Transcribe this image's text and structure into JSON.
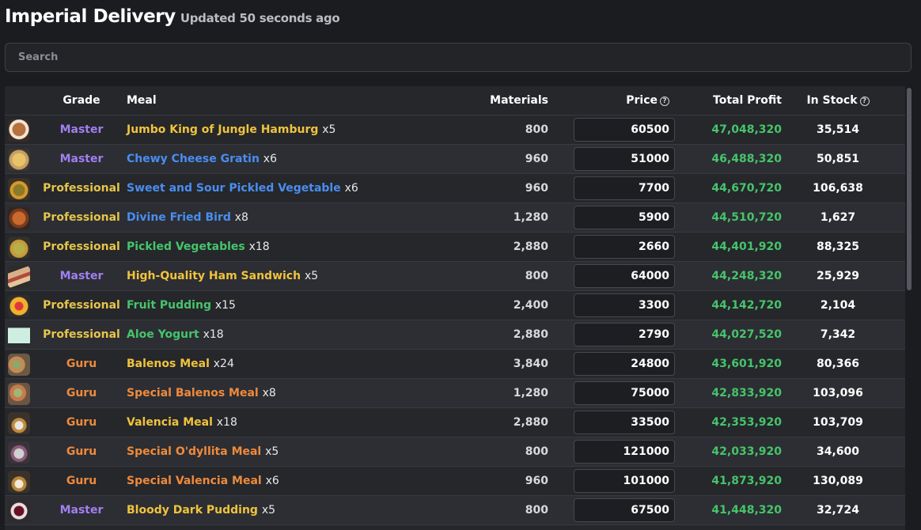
{
  "header": {
    "title": "Imperial Delivery",
    "updated": "Updated 50 seconds ago"
  },
  "search": {
    "placeholder": "Search"
  },
  "columns": {
    "grade": "Grade",
    "meal": "Meal",
    "materials": "Materials",
    "price": "Price",
    "total_profit": "Total Profit",
    "in_stock": "In Stock",
    "help_glyph": "?"
  },
  "colors": {
    "grade": {
      "Master": "#a07ff0",
      "Professional": "#e6c54a",
      "Guru": "#ef8a3c"
    },
    "meal_quality": {
      "yellow": "#f0c33c",
      "blue": "#4a8df0",
      "green": "#46c46b",
      "orange": "#ef8a3c"
    },
    "profit": "#46c46b"
  },
  "rows": [
    {
      "icon": "hamburger-icon",
      "grade": "Master",
      "meal": "Jumbo King of Jungle Hamburg",
      "meal_color": "yellow",
      "qty": "x5",
      "materials": "800",
      "price": "60500",
      "total_profit": "47,048,320",
      "in_stock": "35,514"
    },
    {
      "icon": "gratin-icon",
      "grade": "Master",
      "meal": "Chewy Cheese Gratin",
      "meal_color": "blue",
      "qty": "x6",
      "materials": "960",
      "price": "51000",
      "total_profit": "46,488,320",
      "in_stock": "50,851"
    },
    {
      "icon": "pickled-vegetable-icon",
      "grade": "Professional",
      "meal": "Sweet and Sour Pickled Vegetable",
      "meal_color": "blue",
      "qty": "x6",
      "materials": "960",
      "price": "7700",
      "total_profit": "44,670,720",
      "in_stock": "106,638"
    },
    {
      "icon": "fried-bird-icon",
      "grade": "Professional",
      "meal": "Divine Fried Bird",
      "meal_color": "blue",
      "qty": "x8",
      "materials": "1,280",
      "price": "5900",
      "total_profit": "44,510,720",
      "in_stock": "1,627"
    },
    {
      "icon": "pickled-vegetables-icon",
      "grade": "Professional",
      "meal": "Pickled Vegetables",
      "meal_color": "green",
      "qty": "x18",
      "materials": "2,880",
      "price": "2660",
      "total_profit": "44,401,920",
      "in_stock": "88,325"
    },
    {
      "icon": "ham-sandwich-icon",
      "grade": "Master",
      "meal": "High-Quality Ham Sandwich",
      "meal_color": "yellow",
      "qty": "x5",
      "materials": "800",
      "price": "64000",
      "total_profit": "44,248,320",
      "in_stock": "25,929"
    },
    {
      "icon": "fruit-pudding-icon",
      "grade": "Professional",
      "meal": "Fruit Pudding",
      "meal_color": "green",
      "qty": "x15",
      "materials": "2,400",
      "price": "3300",
      "total_profit": "44,142,720",
      "in_stock": "2,104"
    },
    {
      "icon": "yogurt-icon",
      "grade": "Professional",
      "meal": "Aloe Yogurt",
      "meal_color": "green",
      "qty": "x18",
      "materials": "2,880",
      "price": "2790",
      "total_profit": "44,027,520",
      "in_stock": "7,342"
    },
    {
      "icon": "balenos-meal-icon",
      "grade": "Guru",
      "meal": "Balenos Meal",
      "meal_color": "yellow",
      "qty": "x24",
      "materials": "3,840",
      "price": "24800",
      "total_profit": "43,601,920",
      "in_stock": "80,366"
    },
    {
      "icon": "special-balenos-meal-icon",
      "grade": "Guru",
      "meal": "Special Balenos Meal",
      "meal_color": "orange",
      "qty": "x8",
      "materials": "1,280",
      "price": "75000",
      "total_profit": "42,833,920",
      "in_stock": "103,096"
    },
    {
      "icon": "valencia-meal-icon",
      "grade": "Guru",
      "meal": "Valencia Meal",
      "meal_color": "yellow",
      "qty": "x18",
      "materials": "2,880",
      "price": "33500",
      "total_profit": "42,353,920",
      "in_stock": "103,709"
    },
    {
      "icon": "odyllita-meal-icon",
      "grade": "Guru",
      "meal": "Special O'dyllita Meal",
      "meal_color": "orange",
      "qty": "x5",
      "materials": "800",
      "price": "121000",
      "total_profit": "42,033,920",
      "in_stock": "34,600"
    },
    {
      "icon": "special-valencia-meal-icon",
      "grade": "Guru",
      "meal": "Special Valencia Meal",
      "meal_color": "orange",
      "qty": "x6",
      "materials": "960",
      "price": "101000",
      "total_profit": "41,873,920",
      "in_stock": "130,089"
    },
    {
      "icon": "dark-pudding-icon",
      "grade": "Master",
      "meal": "Bloody Dark Pudding",
      "meal_color": "yellow",
      "qty": "x5",
      "materials": "800",
      "price": "67500",
      "total_profit": "41,448,320",
      "in_stock": "32,724"
    }
  ]
}
